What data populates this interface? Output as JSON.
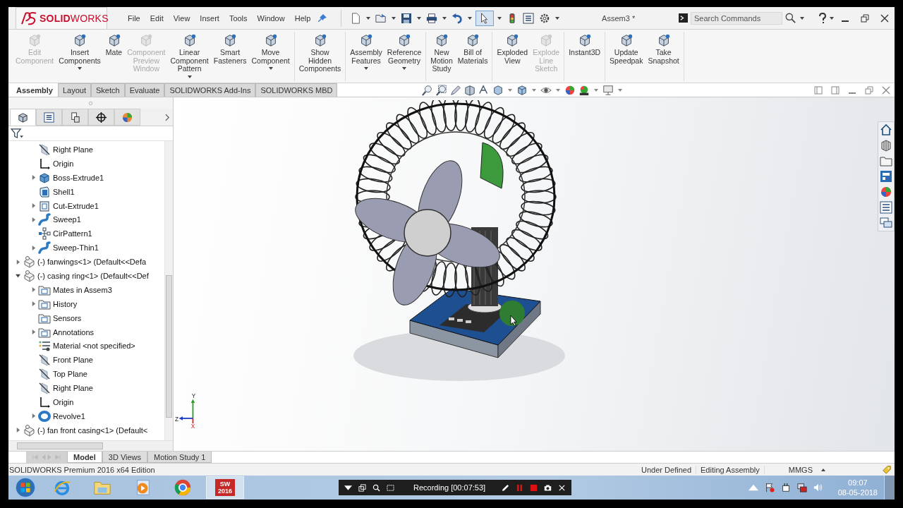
{
  "app": {
    "logo": "**SOLID**WORKS",
    "menu": [
      "File",
      "Edit",
      "View",
      "Insert",
      "Tools",
      "Window",
      "Help"
    ],
    "select_tool": {
      "selected": true
    },
    "title": "Assem3 *",
    "search": {
      "placeholder": "Search Commands"
    }
  },
  "ribbon": {
    "groups": [
      [
        {
          "label": "Edit\nComponent",
          "disabled": true,
          "dropdown": false
        },
        {
          "label": "Insert\nComponents",
          "disabled": false,
          "dropdown": true
        },
        {
          "label": "Mate",
          "disabled": false,
          "dropdown": false
        },
        {
          "label": "Component\nPreview\nWindow",
          "disabled": true,
          "dropdown": false
        },
        {
          "label": "Linear\nComponent\nPattern",
          "disabled": false,
          "dropdown": true
        },
        {
          "label": "Smart\nFasteners",
          "disabled": false,
          "dropdown": false
        },
        {
          "label": "Move\nComponent",
          "disabled": false,
          "dropdown": true
        }
      ],
      [
        {
          "label": "Show\nHidden\nComponents",
          "disabled": false,
          "dropdown": false
        }
      ],
      [
        {
          "label": "Assembly\nFeatures",
          "disabled": false,
          "dropdown": true
        },
        {
          "label": "Reference\nGeometry",
          "disabled": false,
          "dropdown": true
        }
      ],
      [
        {
          "label": "New\nMotion\nStudy",
          "disabled": false,
          "dropdown": false
        },
        {
          "label": "Bill of\nMaterials",
          "disabled": false,
          "dropdown": false
        }
      ],
      [
        {
          "label": "Exploded\nView",
          "disabled": false,
          "dropdown": false
        },
        {
          "label": "Explode\nLine\nSketch",
          "disabled": true,
          "dropdown": false
        }
      ],
      [
        {
          "label": "Instant3D",
          "disabled": false,
          "dropdown": false
        }
      ],
      [
        {
          "label": "Update\nSpeedpak",
          "disabled": false,
          "dropdown": false
        },
        {
          "label": "Take\nSnapshot",
          "disabled": false,
          "dropdown": false
        }
      ]
    ]
  },
  "command_tabs": [
    {
      "label": "Assembly",
      "selected": true
    },
    {
      "label": "Layout",
      "selected": false
    },
    {
      "label": "Sketch",
      "selected": false
    },
    {
      "label": "Evaluate",
      "selected": false
    },
    {
      "label": "SOLIDWORKS Add-Ins",
      "selected": false
    },
    {
      "label": "SOLIDWORKS MBD",
      "selected": false
    }
  ],
  "panel": {
    "tabs": [
      {
        "selected": true
      },
      {
        "selected": false
      },
      {
        "selected": false
      },
      {
        "selected": false
      },
      {
        "selected": false
      }
    ],
    "tree": {
      "items": [
        {
          "children": [
            {
              "label": "Right Plane",
              "kind": "plane"
            },
            {
              "label": "Origin",
              "kind": "origin"
            },
            {
              "label": "Boss-Extrude1",
              "kind": "extrude",
              "expanded": false
            },
            {
              "label": "Shell1",
              "kind": "shell"
            },
            {
              "label": "Cut-Extrude1",
              "kind": "cut",
              "expanded": false
            },
            {
              "label": "Sweep1",
              "kind": "sweep",
              "expanded": false
            },
            {
              "label": "CirPattern1",
              "kind": "pattern"
            },
            {
              "label": "Sweep-Thin1",
              "kind": "sweep",
              "expanded": false
            }
          ]
        },
        {
          "label": "(-) fanwings<1> (Default<<Defa",
          "kind": "component",
          "expanded": false
        },
        {
          "label": "(-) casing ring<1> (Default<<Def",
          "kind": "component",
          "expanded": true,
          "children": [
            {
              "label": "Mates in Assem3",
              "kind": "folder",
              "expanded": false
            },
            {
              "label": "History",
              "kind": "folder",
              "expanded": false
            },
            {
              "label": "Sensors",
              "kind": "folder"
            },
            {
              "label": "Annotations",
              "kind": "folder",
              "expanded": false
            },
            {
              "label": "Material <not specified>",
              "kind": "material"
            },
            {
              "label": "Front Plane",
              "kind": "plane"
            },
            {
              "label": "Top Plane",
              "kind": "plane"
            },
            {
              "label": "Right Plane",
              "kind": "plane"
            },
            {
              "label": "Origin",
              "kind": "origin"
            },
            {
              "label": "Revolve1",
              "kind": "revolve",
              "expanded": false
            }
          ]
        },
        {
          "label": "(-) fan front casing<1> (Default<",
          "kind": "component",
          "expanded": false
        }
      ]
    }
  },
  "bottom_tabs": [
    {
      "label": "Model",
      "selected": true
    },
    {
      "label": "3D Views",
      "selected": false
    },
    {
      "label": "Motion Study 1",
      "selected": false
    }
  ],
  "viewport": {
    "triad": {
      "x": "X",
      "y": "Y",
      "z": "Z"
    }
  },
  "status_bar": {
    "edition": "SOLIDWORKS Premium 2016 x64 Edition",
    "fields": [
      "Under Defined",
      "Editing Assembly",
      "MMGS"
    ]
  },
  "taskbar": {
    "apps": [
      {
        "kind": "browser",
        "selected": false
      },
      {
        "kind": "explorer",
        "selected": false
      },
      {
        "kind": "media",
        "selected": false
      },
      {
        "kind": "chrome",
        "selected": false
      },
      {
        "kind": "cad",
        "selected": true,
        "label": "SW\n2016"
      }
    ],
    "recording": {
      "text": "Recording [00:07:53]"
    },
    "clock": {
      "time": "09:07",
      "date": "08-05-2018"
    }
  }
}
